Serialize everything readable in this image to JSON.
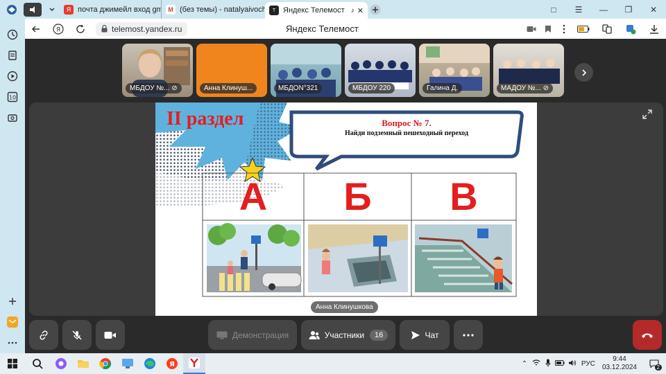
{
  "tabs": [
    {
      "label": "почта джимейл вход gma",
      "favicon": "Я",
      "color": "#e63b2e"
    },
    {
      "label": "(без темы) - natalyaivoch",
      "favicon": "M",
      "color": "#d44638"
    },
    {
      "label": "Яндекс Телемост",
      "favicon": "T",
      "color": "#222"
    }
  ],
  "address": {
    "url": "telemost.yandex.ru",
    "title": "Яндекс Телемост"
  },
  "participants": [
    {
      "name": "МБДОУ №..."
    },
    {
      "name": "Анна Клинуш..."
    },
    {
      "name": "МБДОN°321"
    },
    {
      "name": "МБДОУ 220"
    },
    {
      "name": "Галина Д."
    },
    {
      "name": "МАДОУ №..."
    }
  ],
  "slide": {
    "section": "II раздел",
    "question_no": "Вопрос № 7.",
    "question": "Найди подземный пешеходный переход",
    "letters": [
      "А",
      "Б",
      "В"
    ],
    "presenter": "Анна Клинушкова"
  },
  "toolbar": {
    "demo": "Демонстрация",
    "participants": "Участники",
    "count": "16",
    "chat": "Чат"
  },
  "taskbar": {
    "lang": "РУС",
    "time": "9:44",
    "date": "03.12.2024",
    "notif": "2"
  },
  "colors": {
    "accent_red": "#e41e1e",
    "hangup": "#b42a2a",
    "tile_orange": "#f0851e"
  }
}
